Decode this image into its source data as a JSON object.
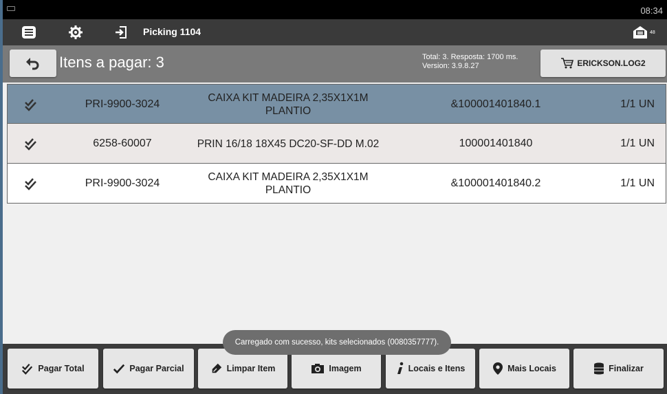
{
  "statusbar": {
    "time": "08:34"
  },
  "appbar": {
    "title": "Picking 1104",
    "message_count": "48"
  },
  "subbar": {
    "title": "Itens a pagar: 3",
    "info_line1": "Total: 3. Resposta: 1700 ms.",
    "info_line2": "Version: 3.9.8.27",
    "user": "ERICKSON.LOG2"
  },
  "items": [
    {
      "code": "PRI-9900-3024",
      "description": "CAIXA KIT MADEIRA 2,35X1X1M PLANTIO",
      "barcode": "&100001401840.1",
      "qty": "1/1 UN"
    },
    {
      "code": "6258-60007",
      "description": "PRIN 16/18 18X45 DC20-SF-DD M.02",
      "barcode": "100001401840",
      "qty": "1/1 UN"
    },
    {
      "code": "PRI-9900-3024",
      "description": "CAIXA KIT MADEIRA 2,35X1X1M PLANTIO",
      "barcode": "&100001401840.2",
      "qty": "1/1 UN"
    }
  ],
  "toast": "Carregado com sucesso, kits selecionados (0080357777).",
  "actions": {
    "pagar_total": "Pagar Total",
    "pagar_parcial": "Pagar Parcial",
    "limpar_item": "Limpar Item",
    "imagem": "Imagem",
    "locais_itens": "Locais e Itens",
    "mais_locais": "Mais Locais",
    "finalizar": "Finalizar"
  },
  "icons": {
    "menu": "menu-icon",
    "settings": "gear-icon",
    "login": "login-icon",
    "messages": "message-icon",
    "back": "undo-icon",
    "cart": "cart-icon",
    "check": "double-check-icon"
  },
  "colors": {
    "selected_row": "#7890a4",
    "alt_row": "#ece8e7",
    "appbar": "#3a3a3a",
    "subbar": "#7a7a7a",
    "bottombar": "#3c3c3c"
  }
}
